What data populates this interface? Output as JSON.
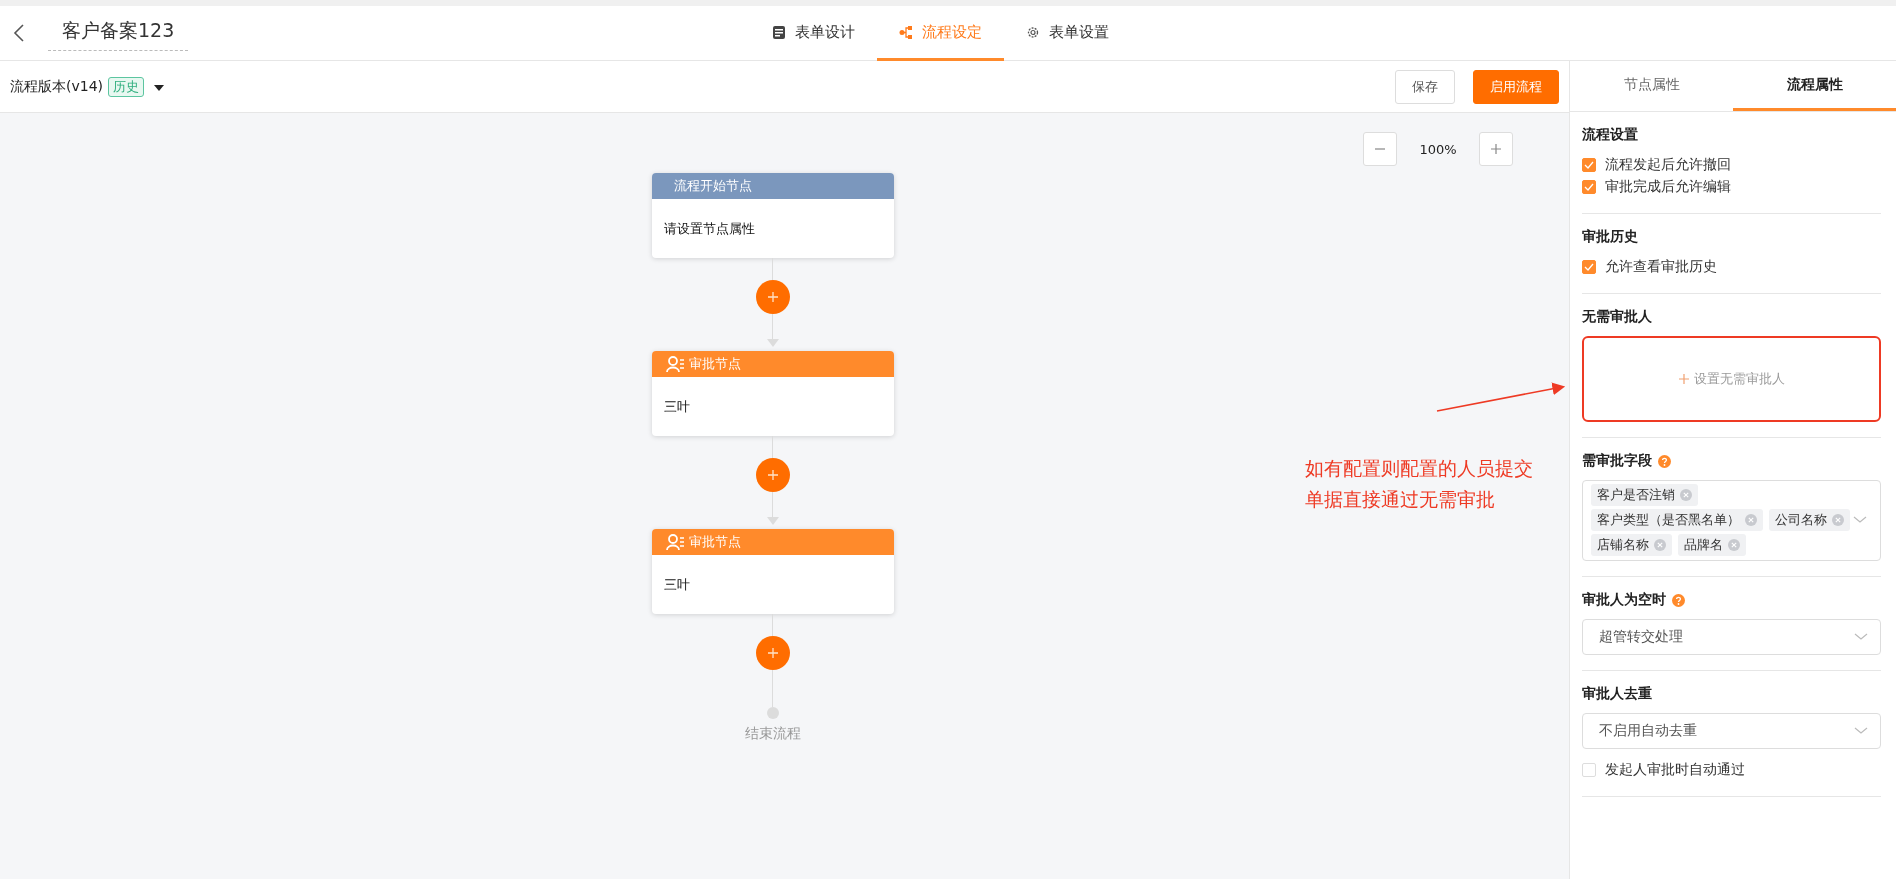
{
  "header": {
    "title": "客户备案123",
    "tabs": [
      {
        "label": "表单设计",
        "selected": false
      },
      {
        "label": "流程设定",
        "selected": true
      },
      {
        "label": "表单设置",
        "selected": false
      }
    ]
  },
  "toolbar": {
    "version": "流程版本(v14)",
    "badge": "历史",
    "buttons": [
      {
        "label": "保存",
        "kind": "default"
      },
      {
        "label": "启用流程",
        "kind": "primary"
      }
    ]
  },
  "canvas": {
    "zoom": "100%",
    "nodes": [
      {
        "kind": "start",
        "title": "流程开始节点",
        "body": "请设置节点属性"
      },
      {
        "kind": "approval",
        "title": "审批节点",
        "body": "三叶"
      },
      {
        "kind": "approval",
        "title": "审批节点",
        "body": "三叶"
      }
    ],
    "end": "结束流程",
    "annotation": "如有配置则配置的人员提交单据直接通过无需审批"
  },
  "panel": {
    "tabs": [
      {
        "label": "节点属性",
        "selected": false
      },
      {
        "label": "流程属性",
        "selected": true
      }
    ],
    "sections": [
      {
        "title": "流程设置",
        "help": false,
        "items": [
          {
            "label": "流程发起后允许撤回",
            "checked": true
          },
          {
            "label": "审批完成后允许编辑",
            "checked": true
          }
        ]
      },
      {
        "title": "审批历史",
        "help": false,
        "items": [
          {
            "label": "允许查看审批历史",
            "checked": true
          }
        ]
      },
      {
        "title": "无需审批人",
        "help": false,
        "picker": {
          "label": "设置无需审批人",
          "highlighted": true
        }
      },
      {
        "title": "需审批字段",
        "help": true,
        "tags": [
          "客户是否注销",
          "客户类型（是否黑名单）",
          "公司名称",
          "店铺名称",
          "品牌名"
        ]
      },
      {
        "title": "审批人为空时",
        "help": true,
        "select": "超管转交处理"
      },
      {
        "title": "审批人去重",
        "help": false,
        "select": "不启用自动去重",
        "items": [
          {
            "label": "发起人审批时自动通过",
            "checked": false
          }
        ]
      }
    ]
  }
}
